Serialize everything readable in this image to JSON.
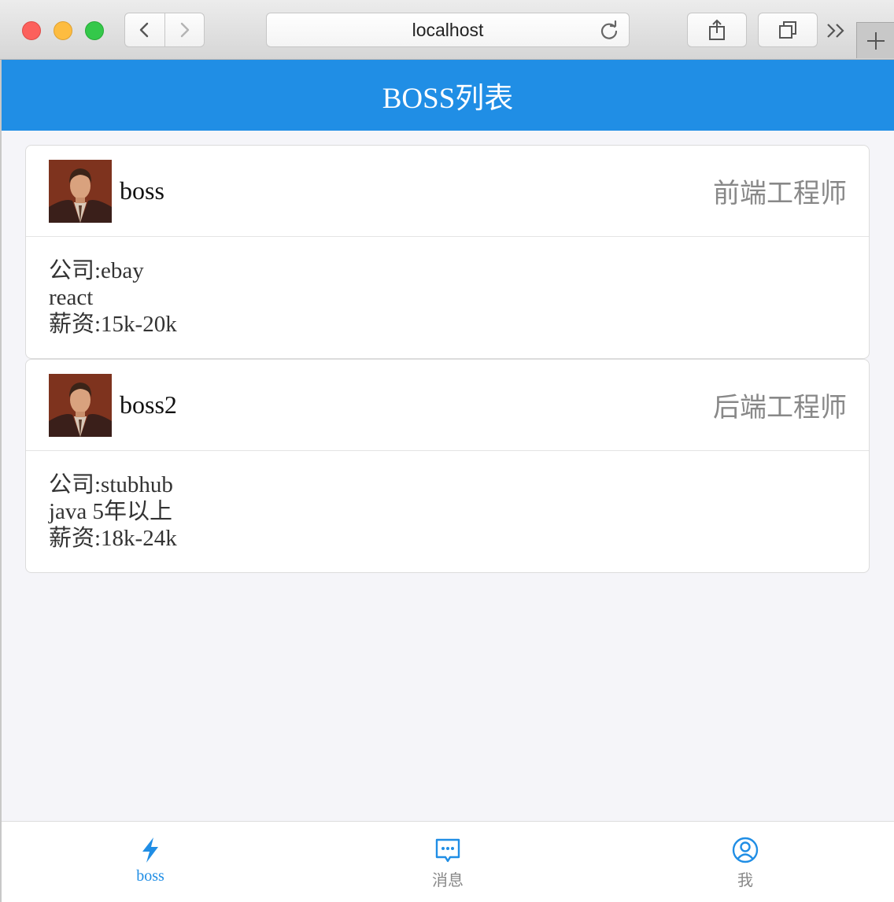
{
  "browser": {
    "url": "localhost"
  },
  "header": {
    "title": "BOSS列表"
  },
  "bosses": [
    {
      "name": "boss",
      "position": "前端工程师",
      "company": "公司:ebay",
      "desc": "react",
      "salary": "薪资:15k-20k"
    },
    {
      "name": "boss2",
      "position": "后端工程师",
      "company": "公司:stubhub",
      "desc": "java 5年以上",
      "salary": "薪资:18k-24k"
    }
  ],
  "tabbar": {
    "items": [
      {
        "label": "boss",
        "icon": "lightning-icon",
        "active": true
      },
      {
        "label": "消息",
        "icon": "message-icon",
        "active": false
      },
      {
        "label": "我",
        "icon": "user-icon",
        "active": false
      }
    ]
  },
  "colors": {
    "accent": "#208ee5",
    "inactive": "#888888"
  }
}
